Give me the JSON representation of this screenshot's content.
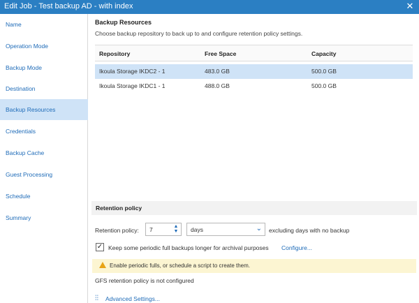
{
  "window": {
    "title": "Edit Job - Test backup AD - with index",
    "close_glyph": "✕"
  },
  "sidebar": {
    "items": [
      {
        "label": "Name"
      },
      {
        "label": "Operation Mode"
      },
      {
        "label": "Backup Mode"
      },
      {
        "label": "Destination"
      },
      {
        "label": "Backup Resources",
        "active": true
      },
      {
        "label": "Credentials"
      },
      {
        "label": "Backup Cache"
      },
      {
        "label": "Guest Processing"
      },
      {
        "label": "Schedule"
      },
      {
        "label": "Summary"
      }
    ]
  },
  "main": {
    "title": "Backup Resources",
    "description": "Choose backup repository to back up to and configure retention policy settings.",
    "table": {
      "headers": [
        "Repository",
        "Free Space",
        "Capacity"
      ],
      "rows": [
        {
          "repository": "Ikoula Storage IKDC2 - 1",
          "free_space": "483.0 GB",
          "capacity": "500.0 GB",
          "selected": true
        },
        {
          "repository": "Ikoula Storage IKDC1 - 1",
          "free_space": "488.0 GB",
          "capacity": "500.0 GB",
          "selected": false
        }
      ]
    },
    "retention": {
      "section_title": "Retention policy",
      "label": "Retention policy:",
      "value": "7",
      "unit": "days",
      "unit_suffix": "excluding days with no backup",
      "keep_gfs_label": "Keep some periodic full backups longer for archival purposes",
      "keep_gfs_checked": true,
      "configure_link": "Configure...",
      "warning": "Enable periodic fulls, or schedule a script to create them.",
      "gfs_status": "GFS retention policy is not configured",
      "advanced_link": "Advanced Settings..."
    }
  },
  "colors": {
    "titlebar": "#2b7fc3",
    "accent": "#1e6bb8",
    "selected_row": "#cfe3f7",
    "warning_bg": "#fcf5d2"
  }
}
